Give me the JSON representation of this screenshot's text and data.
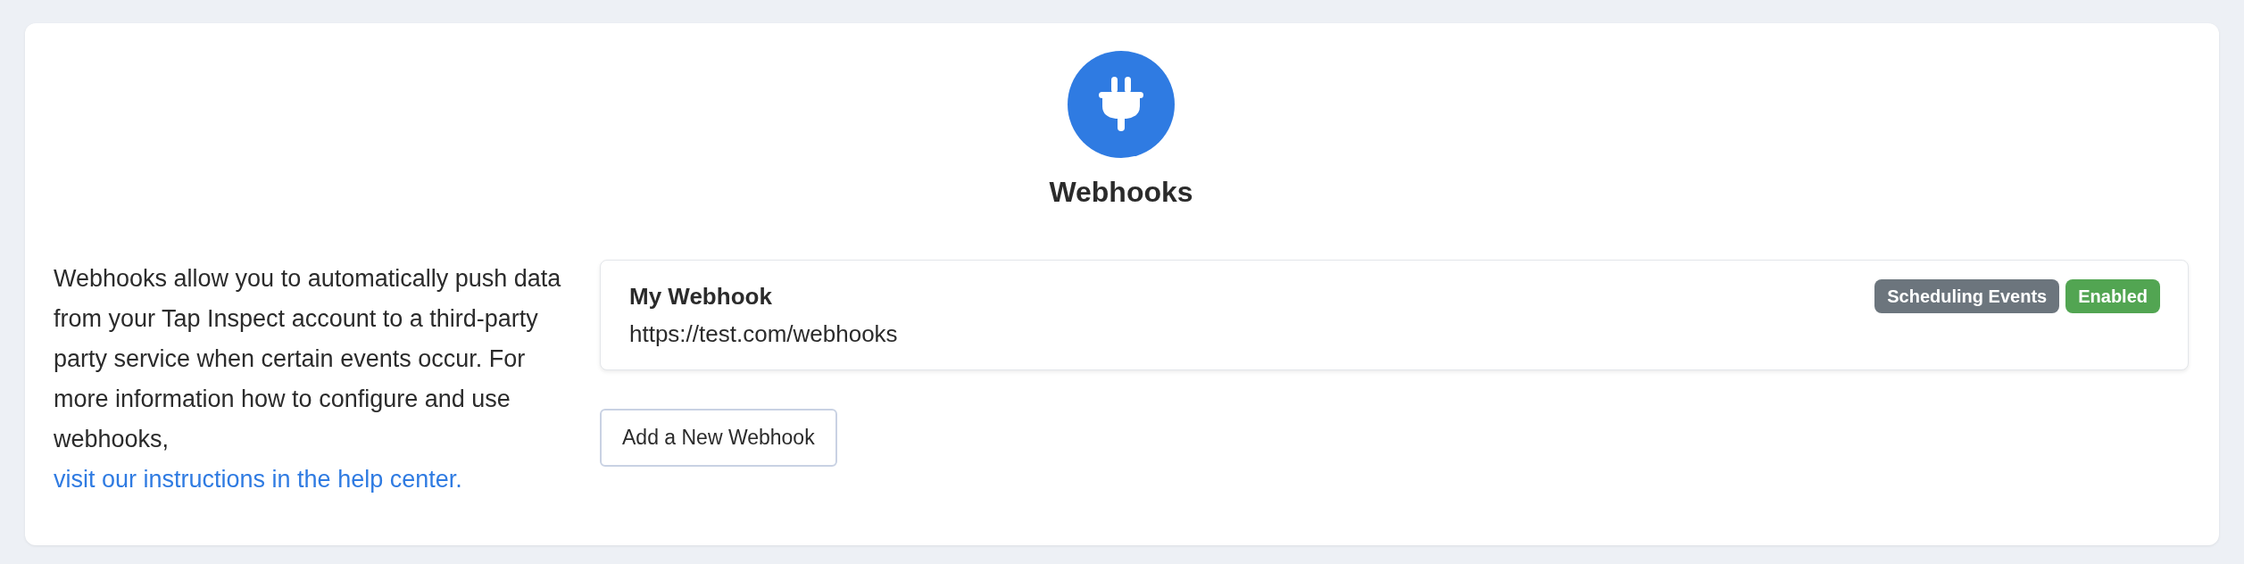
{
  "header": {
    "title": "Webhooks"
  },
  "description": {
    "text": "Webhooks allow you to automatically push data from your Tap Inspect account to a third-party party service when certain events occur. For more information how to configure and use webhooks, ",
    "link": "visit our instructions in the help center."
  },
  "webhooks": [
    {
      "name": "My Webhook",
      "url": "https://test.com/webhooks",
      "tags": [
        {
          "label": "Scheduling Events",
          "color": "#6c757d"
        },
        {
          "label": "Enabled",
          "color": "#52a552"
        }
      ]
    }
  ],
  "add_button": {
    "label": "Add a New Webhook"
  }
}
